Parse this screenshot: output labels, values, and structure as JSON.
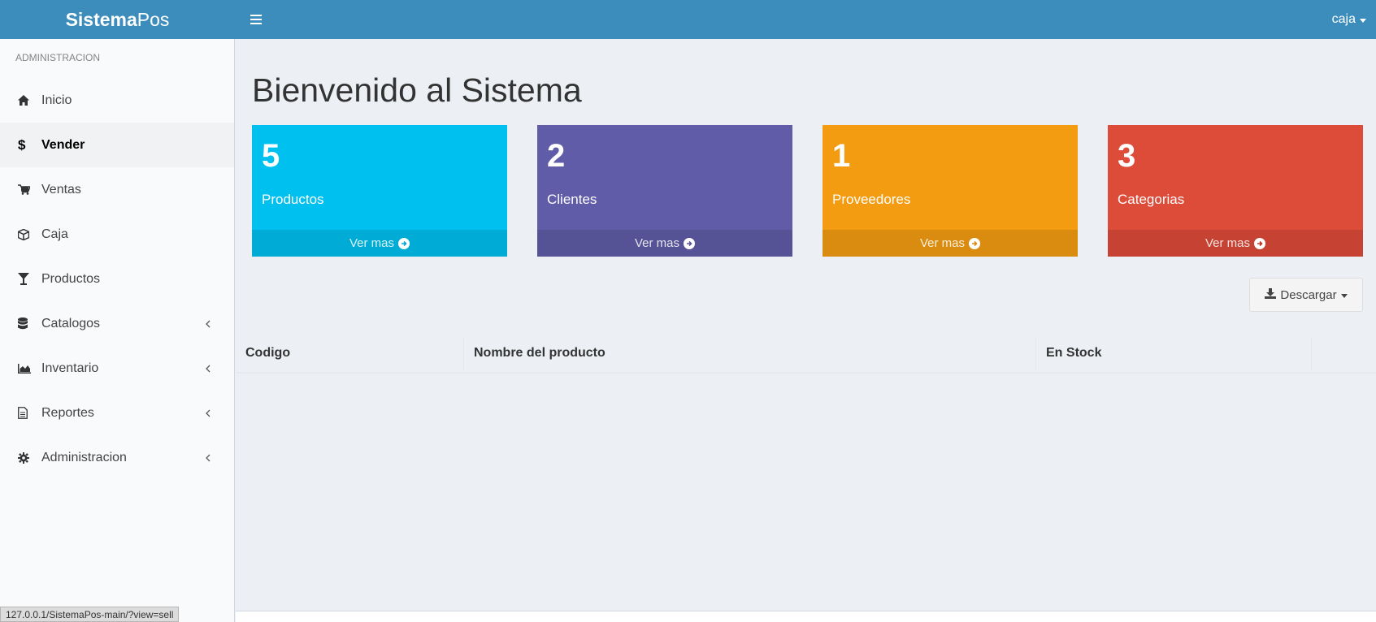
{
  "header": {
    "logo_bold": "Sistema",
    "logo_light": "Pos",
    "user": "caja"
  },
  "sidebar": {
    "section_title": "ADMINISTRACION",
    "items": [
      {
        "label": "Inicio",
        "icon": "home-icon",
        "active": false,
        "submenu": false
      },
      {
        "label": "Vender",
        "icon": "dollar-icon",
        "active": true,
        "submenu": false
      },
      {
        "label": "Ventas",
        "icon": "cart-icon",
        "active": false,
        "submenu": false
      },
      {
        "label": "Caja",
        "icon": "cube-icon",
        "active": false,
        "submenu": false
      },
      {
        "label": "Productos",
        "icon": "glass-icon",
        "active": false,
        "submenu": false
      },
      {
        "label": "Catalogos",
        "icon": "database-icon",
        "active": false,
        "submenu": true
      },
      {
        "label": "Inventario",
        "icon": "area-chart-icon",
        "active": false,
        "submenu": true
      },
      {
        "label": "Reportes",
        "icon": "file-icon",
        "active": false,
        "submenu": true
      },
      {
        "label": "Administracion",
        "icon": "gear-icon",
        "active": false,
        "submenu": true
      }
    ]
  },
  "main": {
    "title": "Bienvenido al Sistema",
    "boxes": [
      {
        "number": "5",
        "label": "Productos",
        "link": "Ver mas",
        "color": "#00c0ef"
      },
      {
        "number": "2",
        "label": "Clientes",
        "link": "Ver mas",
        "color": "#605ca8"
      },
      {
        "number": "1",
        "label": "Proveedores",
        "link": "Ver mas",
        "color": "#f39c12"
      },
      {
        "number": "3",
        "label": "Categorias",
        "link": "Ver mas",
        "color": "#dd4b39"
      }
    ],
    "download_label": "Descargar",
    "table_headers": [
      "Codigo",
      "Nombre del producto",
      "En Stock"
    ]
  },
  "status_url": "127.0.0.1/SistemaPos-main/?view=sell"
}
